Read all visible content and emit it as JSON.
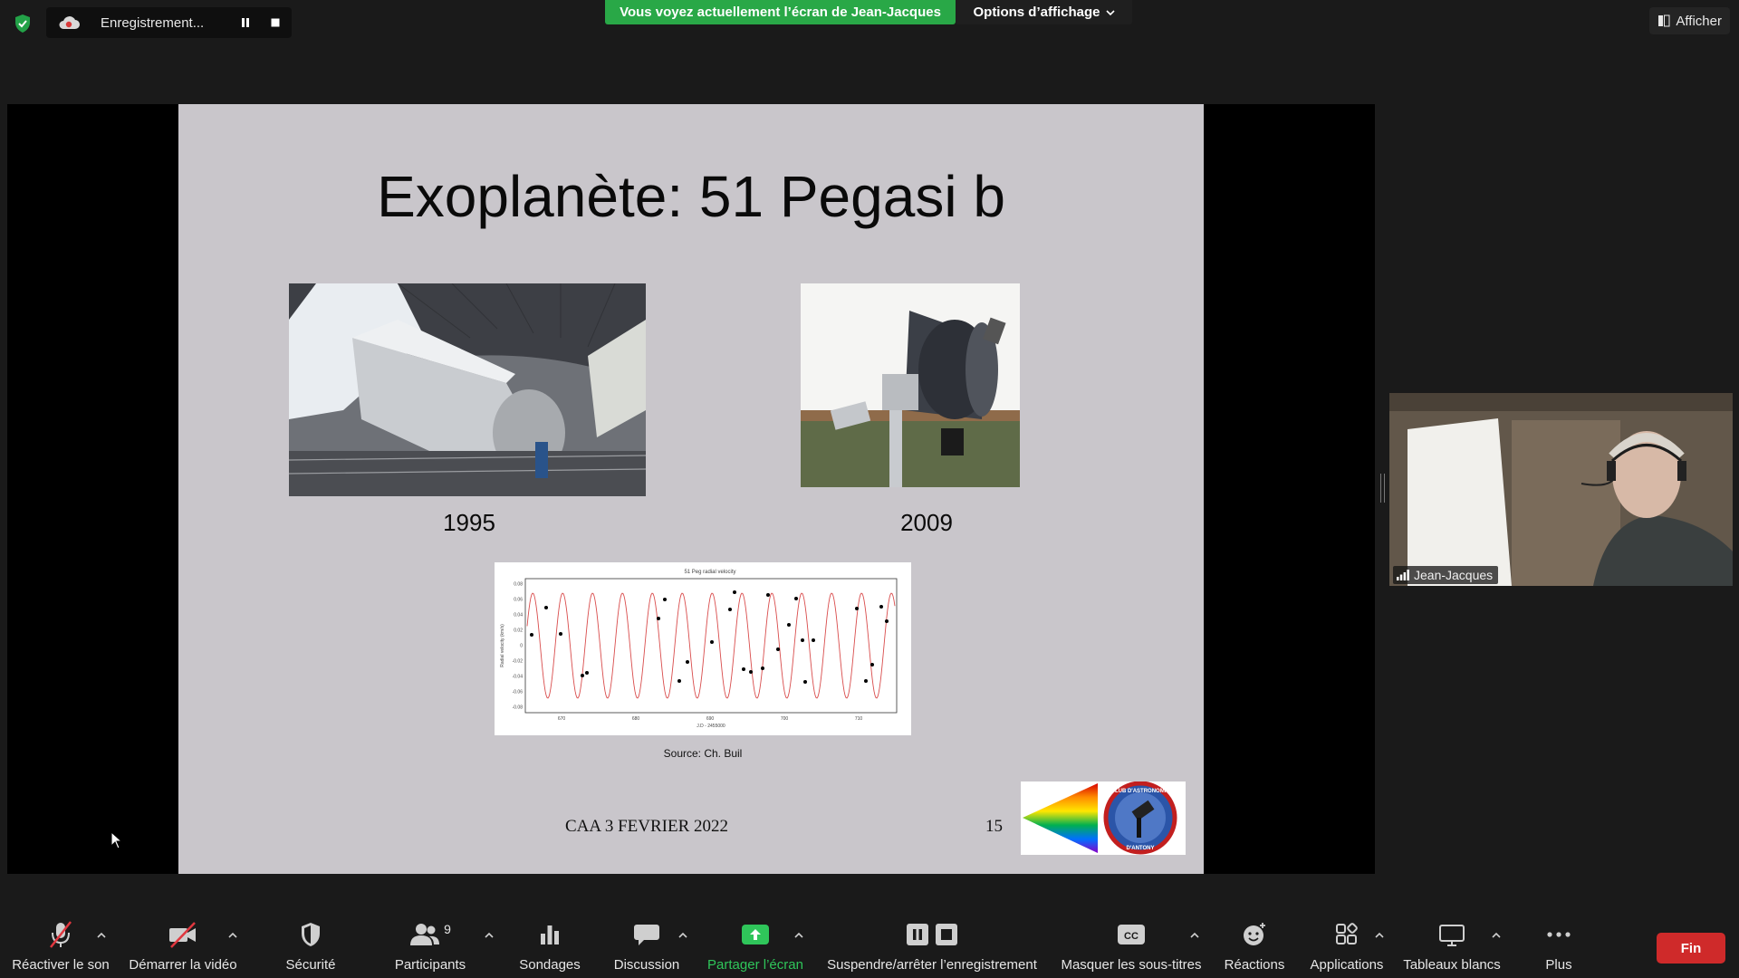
{
  "topbar": {
    "recording_label": "Enregistrement...",
    "share_banner": "Vous voyez actuellement l’écran de Jean-Jacques",
    "view_options": "Options d’affichage",
    "show_label": "Afficher"
  },
  "slide": {
    "title": "Exoplanète: 51 Pegasi b",
    "year_left": "1995",
    "year_right": "2009",
    "plot_title": "51 Peg radial velocity",
    "plot_xlabel": "J.D - 2455000",
    "plot_ylabel": "Radial velocity (km/s)",
    "plot_yticks": [
      "0.08",
      "0.06",
      "0.04",
      "0.02",
      "0",
      "-0.02",
      "-0.04",
      "-0.06",
      "-0.08"
    ],
    "plot_xticks": [
      "670",
      "680",
      "690",
      "700",
      "710"
    ],
    "source": "Source: Ch. Buil",
    "footer": "CAA  3 FEVRIER 2022",
    "page_number": "15",
    "logo_text_top": "CLUB D'ASTRONOMIE",
    "logo_text_bottom": "D'ANTONY"
  },
  "participant": {
    "name": "Jean-Jacques"
  },
  "toolbar": {
    "unmute": "Réactiver le son",
    "start_video": "Démarrer la vidéo",
    "security": "Sécurité",
    "participants": "Participants",
    "participants_count": "9",
    "polls": "Sondages",
    "chat": "Discussion",
    "share_screen": "Partager l’écran",
    "record_control": "Suspendre/arrêter l’enregistrement",
    "captions": "Masquer les sous-titres",
    "captions_icon": "CC",
    "reactions": "Réactions",
    "apps": "Applications",
    "whiteboards": "Tableaux blancs",
    "more": "Plus",
    "end": "Fin"
  },
  "colors": {
    "share_green": "#29a847",
    "end_red": "#cf2a2a",
    "muted_red": "#e0373f"
  }
}
